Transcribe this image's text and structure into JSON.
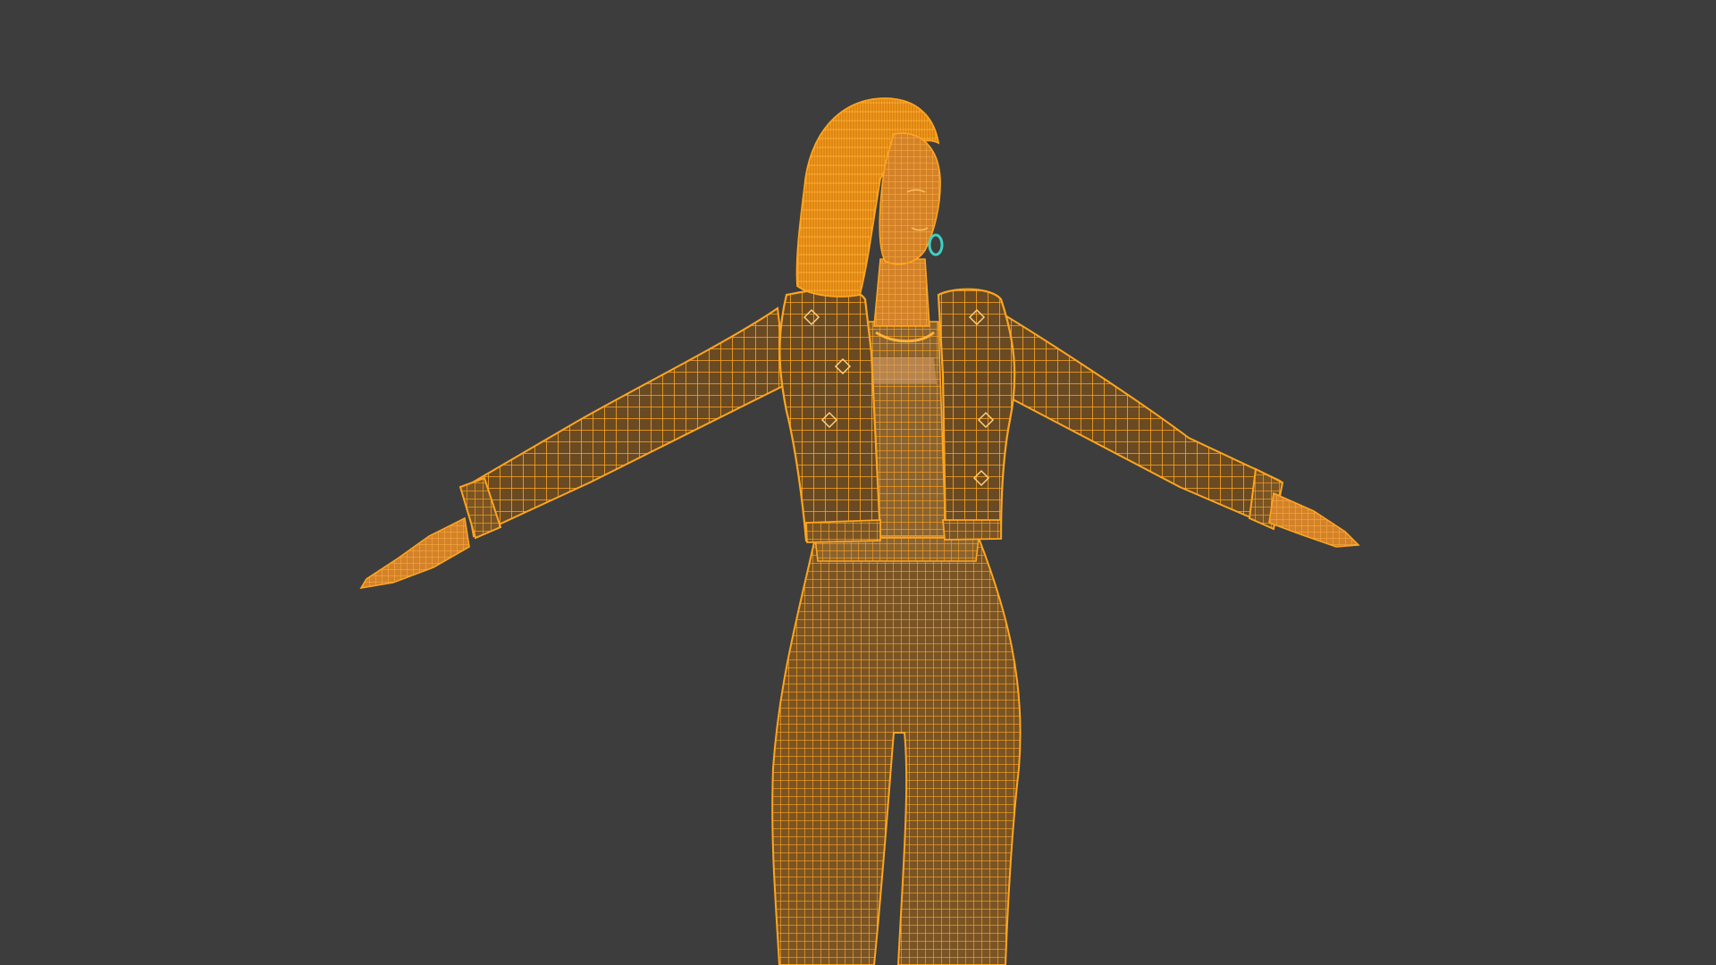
{
  "viewport": {
    "background_color": "#3d3d3d",
    "wireframe_color": "#ff9f1a",
    "wireframe_fill_color": "#b06c0e",
    "accessory_color": "#3fd0c4",
    "view_mode": "wireframe",
    "object": "character-mesh-t-pose"
  }
}
